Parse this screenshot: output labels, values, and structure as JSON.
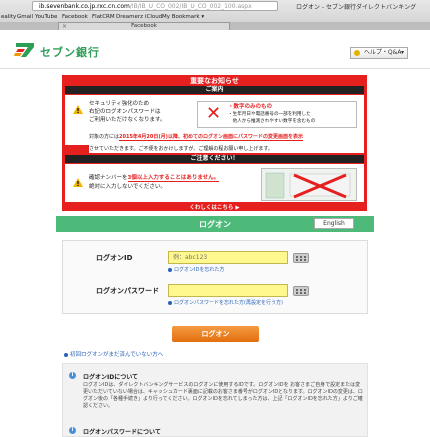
{
  "browser": {
    "url_host": "ib.sevenbank.co.jp",
    "url_path": "/IB/IB_U_CO_002/IB_U_CO_002_100.aspx",
    "url_display": "ib.sevenbank.co.jp.rxc.cn.com",
    "window_title": "ログオン - セブン銀行ダイレクトバンキング",
    "bookmarks": [
      "eality",
      "Gmail",
      "YouTube",
      "Facebook",
      "FlatCRM",
      "Dreamerz",
      "iCloud",
      "My Bookmark ▾"
    ],
    "tab_label": "Facebook"
  },
  "header": {
    "logo_text": "セブン銀行",
    "help_label": "ヘルプ・Q&A"
  },
  "notice": {
    "title": "重要なお知らせ",
    "guide_bar": "ご案内",
    "guide_text_1": "セキュリティ強化のため",
    "guide_text_2": "右記のログオンパスワードは",
    "guide_text_3": "ご利用いただけなくなります。",
    "rule_title": "・数字のみのもの",
    "rule_text_1": "・生年月日や電話番号の一部を利用した",
    "rule_text_2": "　他人から推測されやすい数字を含むもの",
    "target_text_1": "対象の方には",
    "target_date": "2015年4月20日(月)以降、初めてのログオン画面にパスワードの変更画面を表示",
    "target_text_2": "させていただきます。ご不便をおかけしますが、ご理解の程お願い申し上げます。",
    "caution_bar": "ご注意ください！",
    "caution_text_1": "確認ナンバーを",
    "caution_emph": "3個以上入力することはありません。",
    "caution_text_2": "絶対に入力しないでください。",
    "more_link": "くわしくはこちら ▶"
  },
  "login": {
    "title": "ログオン",
    "english_button": "English",
    "id_label": "ログオンID",
    "id_placeholder": "例：abc123",
    "id_forgot": "ログオンIDを忘れた方",
    "pw_label": "ログオンパスワード",
    "pw_forgot": "ログオンパスワードを忘れた方(再設定を行う方)",
    "submit": "ログオン",
    "first_link": "初回ログオンがまだ済んでいない方へ"
  },
  "info": {
    "h1": "ログオンIDについて",
    "t1": "ログオンIDは、ダイレクトバンキングサービスのログオンに使用するIDです。ログオンIDを お客さまご自身で設定または変更いただいていない場合は、キャッシュカード裏面に記載のお客さま番号がログオンIDとなります。ログオンIDの変更は、ログオン後の「各種手続き」より行ってください。ログオンIDを忘れてしまった方は、上記「ログオンIDを忘れた方」よりご確認ください。",
    "h2": "ログオンパスワードについて"
  },
  "colors": {
    "brand_green": "#2e9e57",
    "login_bar": "#4dba7a",
    "notice_red": "#e61f1f",
    "button_orange": "#e36e0d",
    "input_yellow": "#fff88e"
  }
}
